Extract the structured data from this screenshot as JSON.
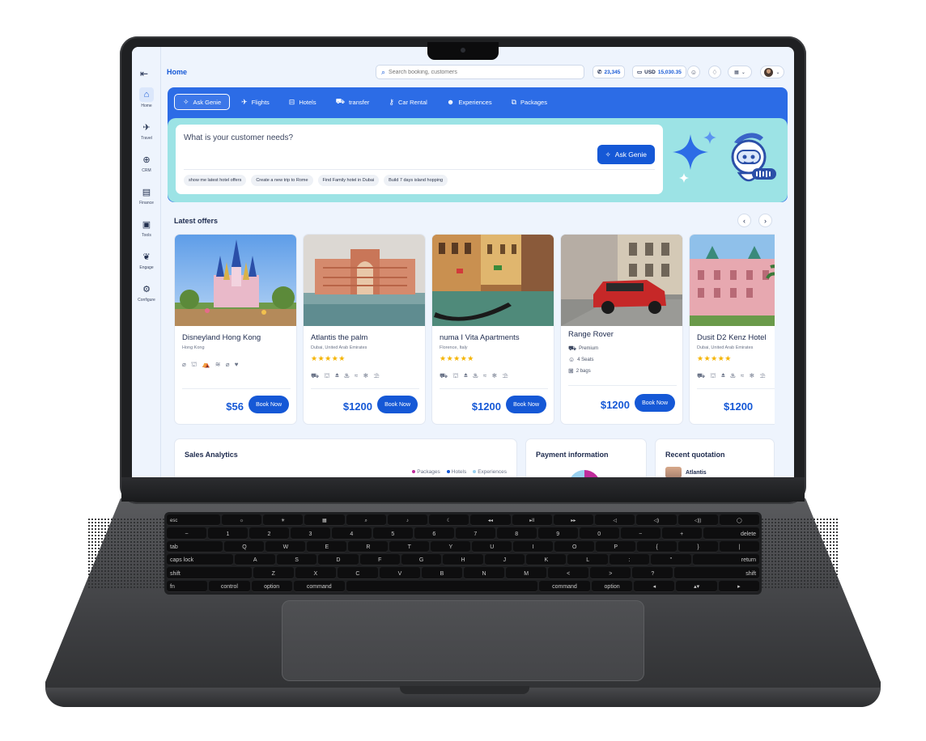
{
  "topbar": {
    "page_title": "Home",
    "search_placeholder": "Search booking, customers",
    "whatsapp_count": "23,345",
    "wallet_currency": "USD",
    "wallet_amount": "15,030.35"
  },
  "sidebar": {
    "items": [
      {
        "label": "Home",
        "icon": "house-icon"
      },
      {
        "label": "Travel",
        "icon": "plane-icon"
      },
      {
        "label": "CRM",
        "icon": "globe-icon"
      },
      {
        "label": "Finance",
        "icon": "document-icon"
      },
      {
        "label": "Tools",
        "icon": "briefcase-icon"
      },
      {
        "label": "Engage",
        "icon": "handshake-icon"
      },
      {
        "label": "Configure",
        "icon": "gear-icon"
      }
    ]
  },
  "hero": {
    "tabs": [
      {
        "label": "Ask Genie",
        "icon": "genie-icon"
      },
      {
        "label": "Flights",
        "icon": "plane-icon"
      },
      {
        "label": "Hotels",
        "icon": "bed-icon"
      },
      {
        "label": "transfer",
        "icon": "car-icon"
      },
      {
        "label": "Car Rental",
        "icon": "key-icon"
      },
      {
        "label": "Experiences",
        "icon": "people-icon"
      },
      {
        "label": "Packages",
        "icon": "package-icon"
      }
    ],
    "question": "What is your customer needs?",
    "ask_button": "Ask Genie",
    "chips": [
      "show me latest hotel offers",
      "Create a new trip to Rome",
      "Find Family hotel in Dubai",
      "Build 7 days island hopping"
    ]
  },
  "offers": {
    "title": "Latest offers",
    "book_label": "Book Now",
    "cards": [
      {
        "name": "Disneyland Hong Kong",
        "location": "Hong Kong",
        "price": "$56",
        "stars": "",
        "amenities": "⌀ ⛫ ⛺ ≋ ⌀ ♥"
      },
      {
        "name": "Atlantis the palm",
        "location": "Dubai, United Arab Emirates",
        "price": "$1200",
        "stars": "★★★★★",
        "amenities": "⛟ ⛫ ⏏ ♨ ≈ ❄ ⛱"
      },
      {
        "name": "numa I Vita Apartments",
        "location": "Florence, Italy",
        "price": "$1200",
        "stars": "★★★★★",
        "amenities": "⛟ ⛫ ⏏ ♨ ≈ ❄ ⛱"
      },
      {
        "name": "Range Rover",
        "location": "",
        "price": "$1200",
        "stars": "",
        "features": [
          "Premium",
          "4 Seats",
          "2 bags"
        ]
      },
      {
        "name": "Dusit D2 Kenz Hotel",
        "location": "Dubai, United Arab Emirates",
        "price": "$1200",
        "stars": "★★★★★",
        "amenities": "⛟ ⛫ ⏏ ♨ ≈ ❄ ⛱"
      }
    ]
  },
  "bottom": {
    "sales_title": "Sales Analytics",
    "legend": [
      "Packages",
      "Hotels",
      "Experiences"
    ],
    "legend_colors": [
      "#c02d9c",
      "#1558d6",
      "#9ad1f0"
    ],
    "payment_title": "Payment information",
    "quotation_title": "Recent quotation",
    "quotation_first": "Atlantis"
  },
  "keyboard": {
    "esc": "esc",
    "delete": "delete",
    "tab": "tab",
    "caps": "caps lock",
    "return": "return",
    "shift": "shift",
    "fn": "fn",
    "control": "control",
    "option": "option",
    "command": "command"
  }
}
